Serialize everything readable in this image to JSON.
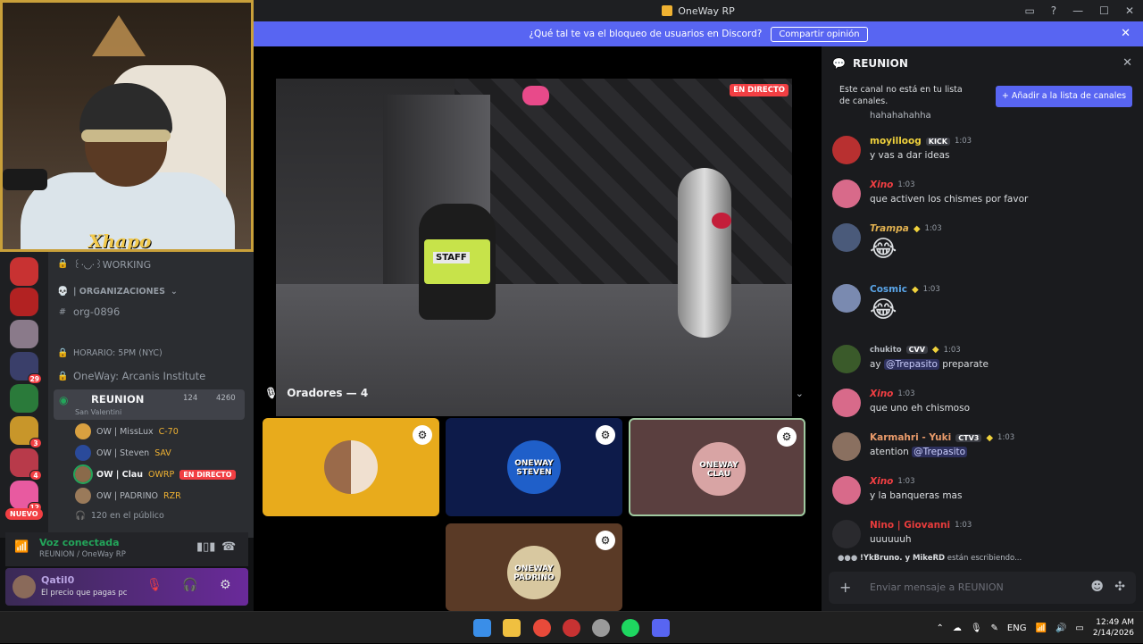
{
  "window": {
    "title": "OneWay RP",
    "controls": [
      "▭",
      "?",
      "—",
      "☐",
      "✕"
    ]
  },
  "notice": {
    "text": "¿Qué tal te va el bloqueo de usuarios en Discord?",
    "button": "Compartir opinión",
    "close": "✕"
  },
  "webcam": {
    "overlay_logo": "Xhapo"
  },
  "servers": [
    {
      "badge": ""
    },
    {
      "badge": ""
    },
    {
      "badge": ""
    },
    {
      "badge": "29"
    },
    {
      "badge": ""
    },
    {
      "badge": "3"
    },
    {
      "badge": "4"
    },
    {
      "badge": "12"
    }
  ],
  "servers_new_label": "NUEVO",
  "channels": {
    "working": "꒰·◟◞·꒱WORKING",
    "org_category": "| ORGANIZACIONES",
    "org_channel": "org-0896",
    "horario": "HORARIO: 5PM (NYC)",
    "arcanis": "OneWay: Arcanis Institute",
    "reunion": {
      "name": "REUNION",
      "count1": "124",
      "count2": "4260",
      "sub": "San Valentini"
    },
    "voice_users": [
      {
        "name": "OW | MissLux",
        "tag": "C-70",
        "live": ""
      },
      {
        "name": "OW | Steven",
        "tag": "SAV",
        "live": ""
      },
      {
        "name": "OW | Clau",
        "tag": "OWRP",
        "live": "EN DIRECTO"
      },
      {
        "name": "OW | PADRINO",
        "tag": "RZR",
        "live": ""
      }
    ],
    "audience": "120 en el público"
  },
  "voice_panel": {
    "status": "Voz conectada",
    "location": "REUNION / OneWay RP"
  },
  "user_panel": {
    "name": "Qatil0",
    "status": "El precio que pagas pc"
  },
  "stage": {
    "live_badge": "EN DIRECTO",
    "vest_text": "STAFF",
    "speakers_label": "Oradores — 4",
    "tiles": [
      {
        "caption": "",
        "bg": "#e8ab1c"
      },
      {
        "caption": "ONEWAY STEVEN",
        "bg": "#0d1b4a"
      },
      {
        "caption": "ONEWAY CLAU",
        "bg": "#5a3f3f"
      },
      {
        "caption": "ONEWAY PADRINO",
        "bg": "#5a3a26"
      }
    ]
  },
  "chat": {
    "title": "REUNION",
    "info": "Este canal no está en tu lista de canales.",
    "add_button": "+ Añadir a la lista de canales",
    "truncated_msg": "hahahahahha",
    "messages": [
      {
        "name": "moyilloog",
        "name_color": "#f0d23c",
        "tag": "KICK",
        "time": "1:03",
        "text": "y vas a dar ideas",
        "emoji": ""
      },
      {
        "name": "Xino",
        "name_color": "#f23f43",
        "tag": "",
        "time": "1:03",
        "text": "que activen los chismes por favor",
        "emoji": ""
      },
      {
        "name": "Trampa",
        "name_color": "#e0b050",
        "tag": "",
        "time": "1:03",
        "text": "",
        "emoji": "😂"
      },
      {
        "name": "Cosmic",
        "name_color": "#5aa5e8",
        "tag": "",
        "time": "1:03",
        "text": "",
        "emoji": "😂"
      },
      {
        "name": "chukito",
        "name_color": "#b5bac1",
        "tag": "CVV",
        "time": "1:03",
        "text": "ay ",
        "mention": "@Trepasito",
        "after": " preparate",
        "emoji": ""
      },
      {
        "name": "Xino",
        "name_color": "#f23f43",
        "tag": "",
        "time": "1:03",
        "text": "que uno eh chismoso",
        "emoji": ""
      },
      {
        "name": "Karmahri - Yuki",
        "name_color": "#e89a6a",
        "tag": "CTV3",
        "time": "1:03",
        "text": "atention ",
        "mention": "@Trepasito",
        "after": "",
        "emoji": ""
      },
      {
        "name": "Xino",
        "name_color": "#f23f43",
        "tag": "",
        "time": "1:03",
        "text": "y la banqueras mas",
        "emoji": ""
      },
      {
        "name": "Nino | Giovanni",
        "name_color": "#e83c3c",
        "tag": "",
        "time": "1:03",
        "text": "uuuuuuh",
        "emoji": ""
      }
    ],
    "typing": {
      "users": "!YkBruno. y MikeRD",
      "suffix": " están escribiendo..."
    },
    "composer_placeholder": "Enviar mensaje a  REUNION"
  },
  "taskbar": {
    "lang": "ENG",
    "time": "12:49 AM",
    "date": "2/14/2026"
  }
}
